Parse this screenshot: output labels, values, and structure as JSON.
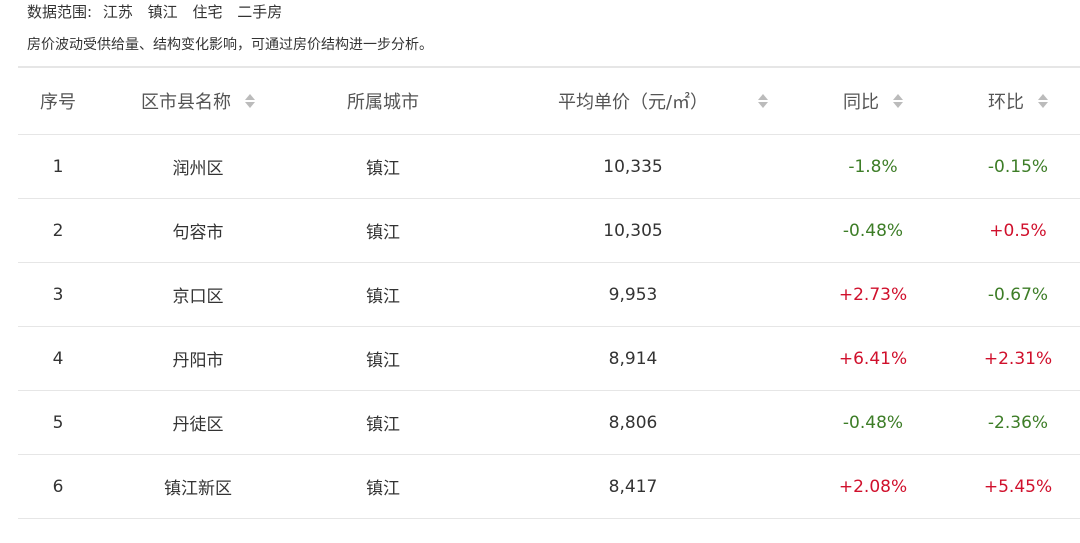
{
  "intro": {
    "scope_label": "数据范围:",
    "scope_items": [
      "江苏",
      "镇江",
      "住宅",
      "二手房"
    ],
    "note": "房价波动受供给量、结构变化影响，可通过房价结构进一步分析。"
  },
  "table": {
    "headers": {
      "index": "序号",
      "district": "区市县名称",
      "city": "所属城市",
      "price": "平均单价（元/㎡）",
      "yoy": "同比",
      "mom": "环比"
    },
    "rows": [
      {
        "index": "1",
        "district": "润州区",
        "city": "镇江",
        "price": "10,335",
        "yoy": "-1.8%",
        "mom": "-0.15%"
      },
      {
        "index": "2",
        "district": "句容市",
        "city": "镇江",
        "price": "10,305",
        "yoy": "-0.48%",
        "mom": "+0.5%"
      },
      {
        "index": "3",
        "district": "京口区",
        "city": "镇江",
        "price": "9,953",
        "yoy": "+2.73%",
        "mom": "-0.67%"
      },
      {
        "index": "4",
        "district": "丹阳市",
        "city": "镇江",
        "price": "8,914",
        "yoy": "+6.41%",
        "mom": "+2.31%"
      },
      {
        "index": "5",
        "district": "丹徒区",
        "city": "镇江",
        "price": "8,806",
        "yoy": "-0.48%",
        "mom": "-2.36%"
      },
      {
        "index": "6",
        "district": "镇江新区",
        "city": "镇江",
        "price": "8,417",
        "yoy": "+2.08%",
        "mom": "+5.45%"
      }
    ]
  },
  "colors": {
    "decrease": "#3d7d27",
    "increase": "#d0102c",
    "border": "#e6e6e6"
  }
}
